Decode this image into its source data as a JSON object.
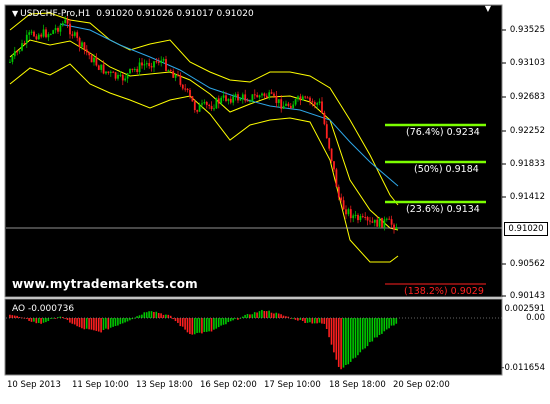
{
  "chart": {
    "symbol": "USDCHF-Pro,H1",
    "ohlc": "0.91020 0.91026 0.91017 0.91020",
    "watermark": "www.mytrademarkets.com",
    "current_price": "0.91020",
    "price_ticks": [
      "0.93525",
      "0.93103",
      "0.92683",
      "0.92252",
      "0.91833",
      "0.91412",
      "0.90562",
      "0.90143"
    ],
    "time_ticks": [
      "10 Sep 2013",
      "11 Sep 10:00",
      "13 Sep 18:00",
      "16 Sep 02:00",
      "17 Sep 10:00",
      "18 Sep 18:00",
      "20 Sep 02:00"
    ],
    "fib_levels": [
      {
        "label": "(76.4%) 0.9234",
        "color": "#7cff00"
      },
      {
        "label": "(50%) 0.9184",
        "color": "#7cff00"
      },
      {
        "label": "(23.6%) 0.9134",
        "color": "#7cff00"
      },
      {
        "label": "(138.2%) 0.9029",
        "color": "#ff2020"
      }
    ]
  },
  "indicator": {
    "label": "AO -0.000736",
    "ticks": [
      "0.002591",
      "0.00",
      "-0.011654"
    ]
  },
  "colors": {
    "background": "#000000",
    "bull_candle": "#00c800",
    "bear_candle": "#ff2020",
    "bollinger": "#ffff00",
    "moving_average": "#2ea6e6",
    "fib_line": "#7cff00",
    "target_line": "#ff2020",
    "price_line": "#c0c0c0"
  }
}
